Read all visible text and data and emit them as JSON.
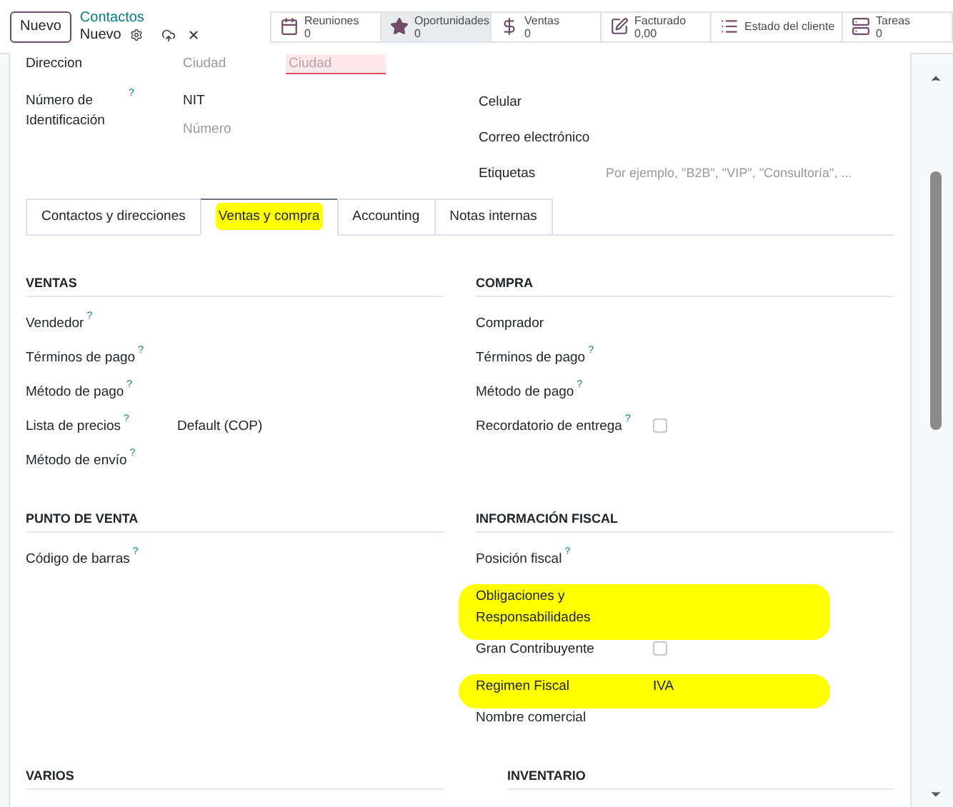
{
  "toolbar": {
    "new_button": "Nuevo",
    "breadcrumb": "Contactos",
    "record": "Nuevo"
  },
  "stat_buttons": [
    {
      "label": "Reuniones",
      "value": "0",
      "selected": false
    },
    {
      "label": "Oportunidades",
      "value": "0",
      "selected": true
    },
    {
      "label": "Ventas",
      "value": "0",
      "selected": false
    },
    {
      "label": "Facturado",
      "value": "0,00",
      "selected": false
    },
    {
      "label": "Estado del cliente",
      "selected": false
    },
    {
      "label": "Tareas",
      "value": "0",
      "selected": false
    }
  ],
  "address": {
    "label": "Direccion",
    "city_placeholder": "Ciudad",
    "state_placeholder": "Ciudad",
    "state_invalid": true
  },
  "identification": {
    "label": "Número de Identificación",
    "help": "?",
    "type": "NIT",
    "number_placeholder": "Número"
  },
  "contact_fields": [
    {
      "label": "Celular"
    },
    {
      "label": "Correo electrónico"
    },
    {
      "label": "Etiquetas",
      "placeholder": "Por ejemplo, \"B2B\", \"VIP\", \"Consultoría\", ..."
    }
  ],
  "tabs": [
    {
      "label": "Contactos y direcciones",
      "selected": false,
      "highlighted": false
    },
    {
      "label": "Ventas y compra",
      "selected": true,
      "highlighted": true
    },
    {
      "label": "Accounting",
      "selected": false,
      "highlighted": false
    },
    {
      "label": "Notas internas",
      "selected": false,
      "highlighted": false
    }
  ],
  "sections": [
    {
      "title": "VENTAS",
      "fields": [
        {
          "kind": "text",
          "label": "Vendedor",
          "help": "?",
          "highlighted": false
        },
        {
          "kind": "text",
          "label": "Términos de pago",
          "help": "?",
          "highlighted": false
        },
        {
          "kind": "text",
          "label": "Método de pago",
          "help": "?",
          "highlighted": false
        },
        {
          "kind": "text",
          "label": "Lista de precios",
          "help": "?",
          "value": "Default (COP)",
          "highlighted": false
        },
        {
          "kind": "text",
          "label": "Método de envío",
          "help": "?",
          "highlighted": false
        }
      ]
    },
    {
      "title": "COMPRA",
      "fields": [
        {
          "kind": "text",
          "label": "Comprador",
          "highlighted": false
        },
        {
          "kind": "text",
          "label": "Términos de pago",
          "help": "?",
          "highlighted": false
        },
        {
          "kind": "text",
          "label": "Método de pago",
          "help": "?",
          "highlighted": false
        },
        {
          "kind": "checkbox",
          "label": "Recordatorio de entrega",
          "help": "?",
          "checked": false,
          "highlighted": false
        }
      ]
    },
    {
      "title": "PUNTO DE VENTA",
      "fields": [
        {
          "kind": "text",
          "label": "Código de barras",
          "help": "?",
          "highlighted": false
        }
      ]
    },
    {
      "title": "INFORMACIÓN FISCAL",
      "fields": [
        {
          "kind": "text",
          "label": "Posición fiscal",
          "help": "?",
          "highlighted": false
        },
        {
          "kind": "text",
          "label": "Obligaciones y Responsabilidades",
          "highlighted": true
        },
        {
          "kind": "checkbox",
          "label": "Gran Contribuyente",
          "checked": false,
          "highlighted": false
        },
        {
          "kind": "text",
          "label": "Regimen Fiscal",
          "value": "IVA",
          "highlighted": true
        },
        {
          "kind": "text",
          "label": "Nombre comercial",
          "highlighted": false
        }
      ]
    },
    {
      "title": "VARIOS"
    },
    {
      "title": "INVENTARIO"
    }
  ]
}
